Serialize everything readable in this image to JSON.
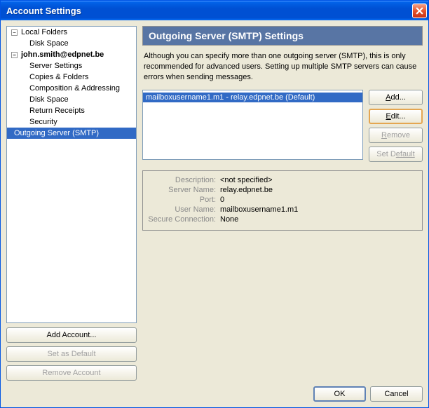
{
  "window": {
    "title": "Account Settings"
  },
  "tree": {
    "localFolders": "Local Folders",
    "diskSpace1": "Disk Space",
    "account": "john.smith@edpnet.be",
    "serverSettings": "Server Settings",
    "copiesFolders": "Copies & Folders",
    "composition": "Composition & Addressing",
    "diskSpace2": "Disk Space",
    "returnReceipts": "Return Receipts",
    "security": "Security",
    "outgoing": "Outgoing Server (SMTP)"
  },
  "leftButtons": {
    "addAccount": "Add Account...",
    "setDefault": "Set as Default",
    "removeAccount": "Remove Account"
  },
  "section": {
    "heading": "Outgoing Server (SMTP) Settings",
    "intro": "Although you can specify more than one outgoing server (SMTP), this is only recommended for advanced users. Setting up multiple SMTP servers can cause errors when sending messages."
  },
  "serverList": {
    "item0": "mailboxusername1.m1 - relay.edpnet.be (Default)"
  },
  "serverButtons": {
    "add": "dd...",
    "edit": "dit...",
    "remove": "emove",
    "setDefault": "efault"
  },
  "serverButtonPrefixes": {
    "add": "A",
    "edit": "E",
    "remove": "R",
    "setDefault": "Set D"
  },
  "details": {
    "labels": {
      "description": "Description:",
      "serverName": "Server Name:",
      "port": "Port:",
      "userName": "User Name:",
      "secure": "Secure Connection:"
    },
    "values": {
      "description": "<not specified>",
      "serverName": "relay.edpnet.be",
      "port": "0",
      "userName": "mailboxusername1.m1",
      "secure": "None"
    }
  },
  "footer": {
    "ok": "OK",
    "cancel": "Cancel"
  },
  "expanders": {
    "minus": "−"
  }
}
